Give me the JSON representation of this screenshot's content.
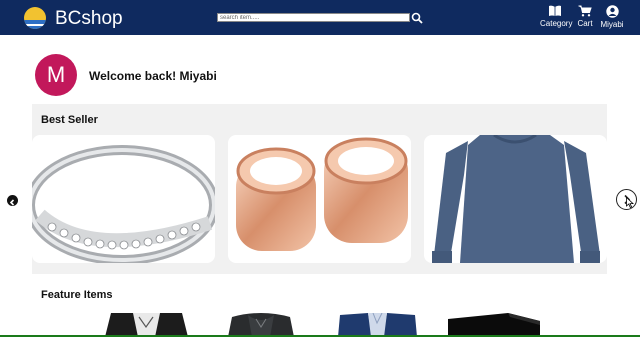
{
  "header": {
    "brand": "BCshop",
    "search_placeholder": "search item.....",
    "nav": [
      {
        "label": "Category",
        "icon": "book-icon"
      },
      {
        "label": "Cart",
        "icon": "cart-icon"
      },
      {
        "label": "Miyabi",
        "icon": "user-icon"
      }
    ]
  },
  "user": {
    "avatar_letter": "M",
    "welcome": "Welcome back! Miyabi"
  },
  "best_seller": {
    "title": "Best Seller",
    "items": [
      {
        "image": "silver-diamond-ring"
      },
      {
        "image": "rose-gold-ear-tunnels"
      },
      {
        "image": "blue-long-sleeve-shirt"
      }
    ]
  },
  "feature_items": {
    "title": "Feature Items",
    "items": [
      {
        "image": "black-white-jacket"
      },
      {
        "image": "black-leather-jacket"
      },
      {
        "image": "navy-blazer"
      },
      {
        "image": "black-product"
      }
    ]
  },
  "colors": {
    "navbar": "#0f2a5f",
    "avatar": "#c2185b",
    "panel": "#f1f1f1"
  }
}
